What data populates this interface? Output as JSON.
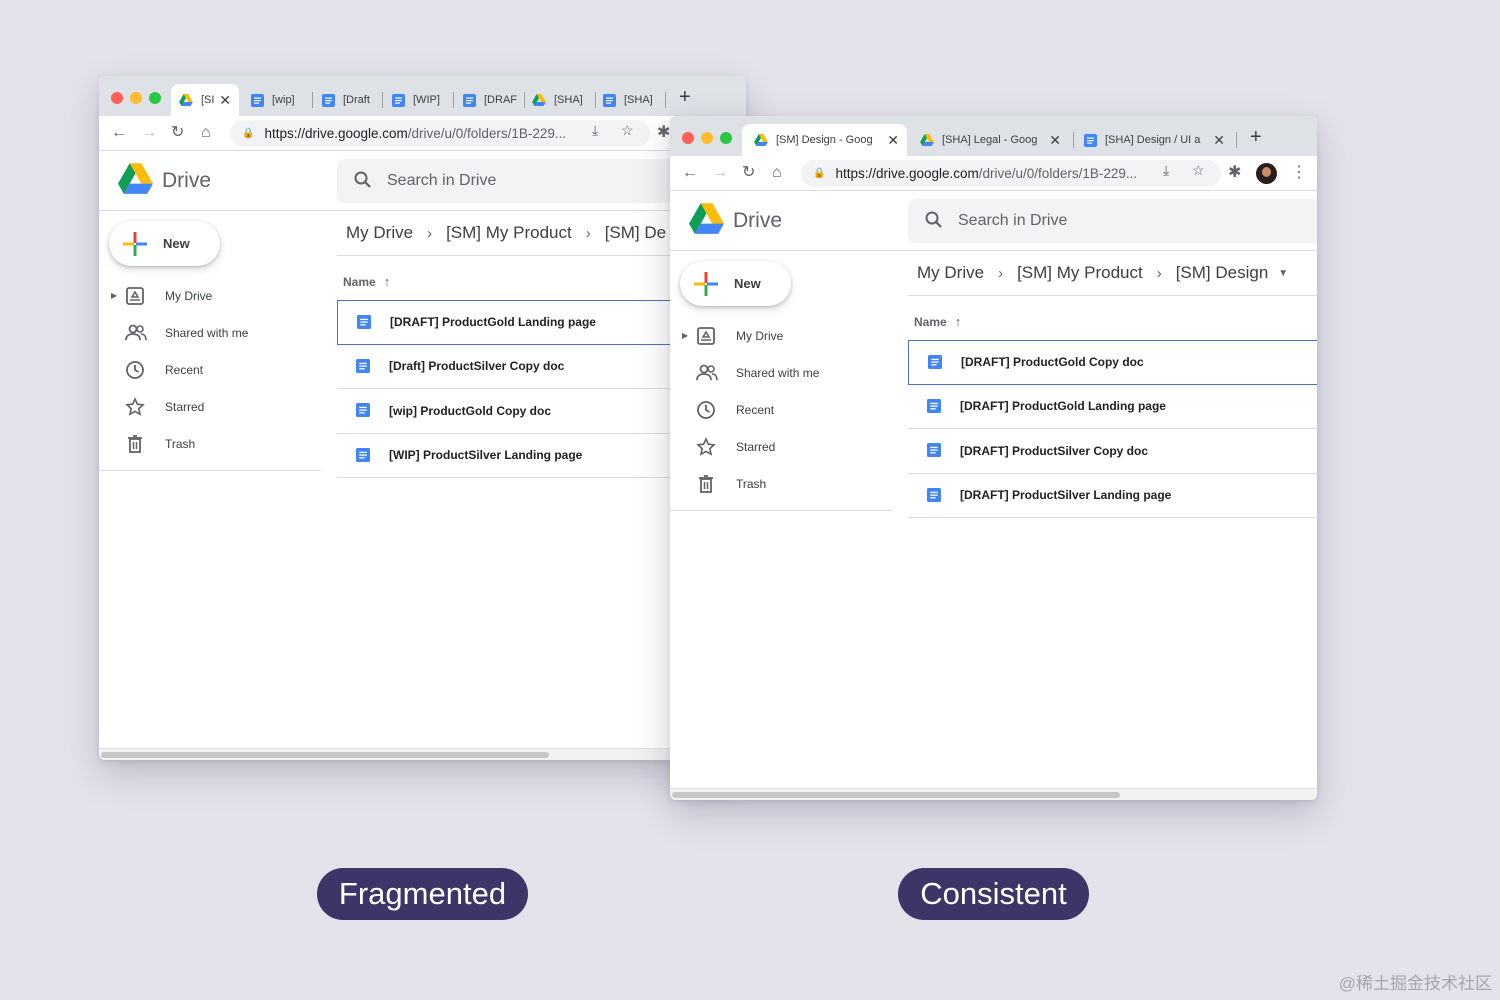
{
  "browser": {
    "traffic_lights": [
      "#ff5f57",
      "#febc2e",
      "#28c840"
    ],
    "url_host": "https://drive.google.com",
    "url_path": "/drive/u/0/folders/1B-229..."
  },
  "drive": {
    "title": "Drive",
    "search_placeholder": "Search in Drive",
    "new_label": "New",
    "name_header": "Name",
    "nav": [
      {
        "label": "My Drive"
      },
      {
        "label": "Shared with me"
      },
      {
        "label": "Recent"
      },
      {
        "label": "Starred"
      },
      {
        "label": "Trash"
      }
    ]
  },
  "fragmented": {
    "tabs": [
      "[SI",
      "[wip] ",
      "[Draft",
      "[WIP]",
      "[DRAF",
      "[SHA]",
      "[SHA]"
    ],
    "breadcrumb": [
      "My Drive",
      "[SM] My Product",
      "[SM] De"
    ],
    "files": [
      "[DRAFT] ProductGold Landing page",
      "[Draft] ProductSilver Copy doc",
      "[wip] ProductGold Copy doc",
      "[WIP] ProductSilver Landing page"
    ]
  },
  "consistent": {
    "tabs": [
      "[SM] Design - Goog",
      "[SHA] Legal - Goog",
      "[SHA] Design / UI a"
    ],
    "breadcrumb": [
      "My Drive",
      "[SM] My Product",
      "[SM] Design"
    ],
    "files": [
      "[DRAFT] ProductGold Copy doc",
      "[DRAFT] ProductGold Landing page",
      "[DRAFT] ProductSilver Copy doc",
      "[DRAFT] ProductSilver Landing page"
    ]
  },
  "labels": {
    "fragmented": "Fragmented",
    "consistent": "Consistent",
    "watermark": "@稀土掘金技术社区"
  },
  "colors": {
    "background": "#e4e3ec",
    "pill": "#3b3667",
    "doc_blue": "#4285f4",
    "selection_border": "#4e6ec5"
  }
}
